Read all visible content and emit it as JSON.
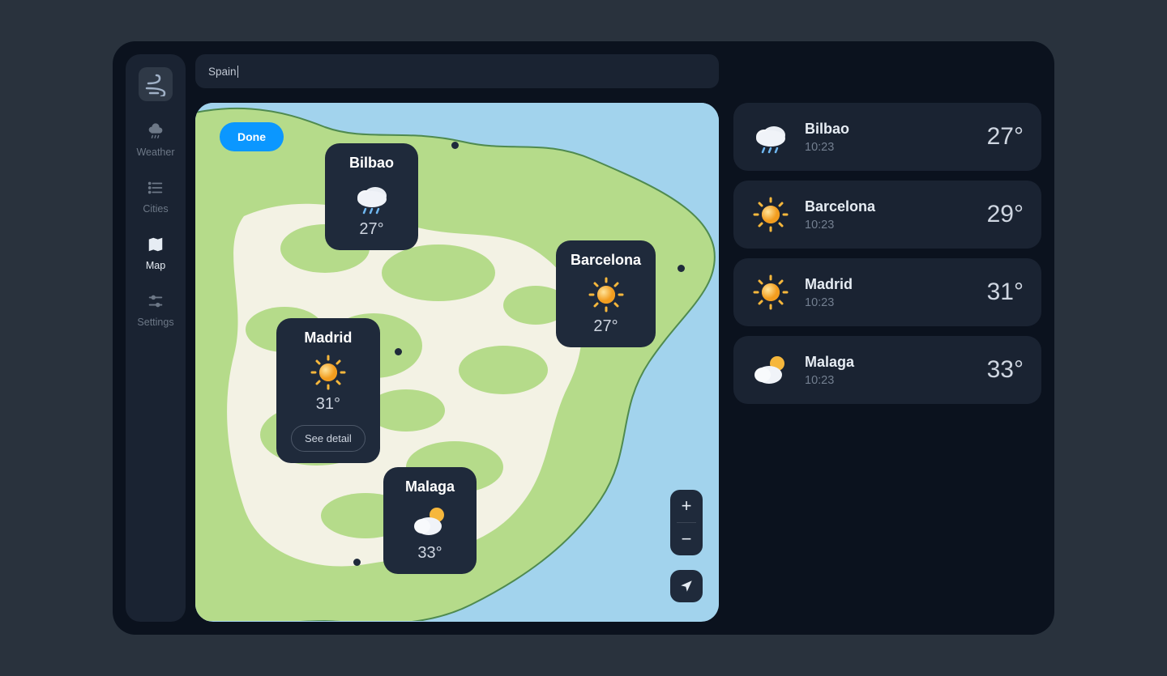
{
  "search": {
    "value": "Spain"
  },
  "sidebar": {
    "items": [
      {
        "label": "Weather"
      },
      {
        "label": "Cities"
      },
      {
        "label": "Map"
      },
      {
        "label": "Settings"
      }
    ]
  },
  "map": {
    "done_label": "Done",
    "see_detail_label": "See detail",
    "pins": [
      {
        "name": "Bilbao",
        "temp": "27°",
        "icon": "rain"
      },
      {
        "name": "Barcelona",
        "temp": "27°",
        "icon": "sun"
      },
      {
        "name": "Madrid",
        "temp": "31°",
        "icon": "sun",
        "has_detail": true
      },
      {
        "name": "Malaga",
        "temp": "33°",
        "icon": "partly"
      }
    ]
  },
  "cities": [
    {
      "name": "Bilbao",
      "time": "10:23",
      "temp": "27°",
      "icon": "rain"
    },
    {
      "name": "Barcelona",
      "time": "10:23",
      "temp": "29°",
      "icon": "sun"
    },
    {
      "name": "Madrid",
      "time": "10:23",
      "temp": "31°",
      "icon": "sun"
    },
    {
      "name": "Malaga",
      "time": "10:23",
      "temp": "33°",
      "icon": "partly"
    }
  ]
}
